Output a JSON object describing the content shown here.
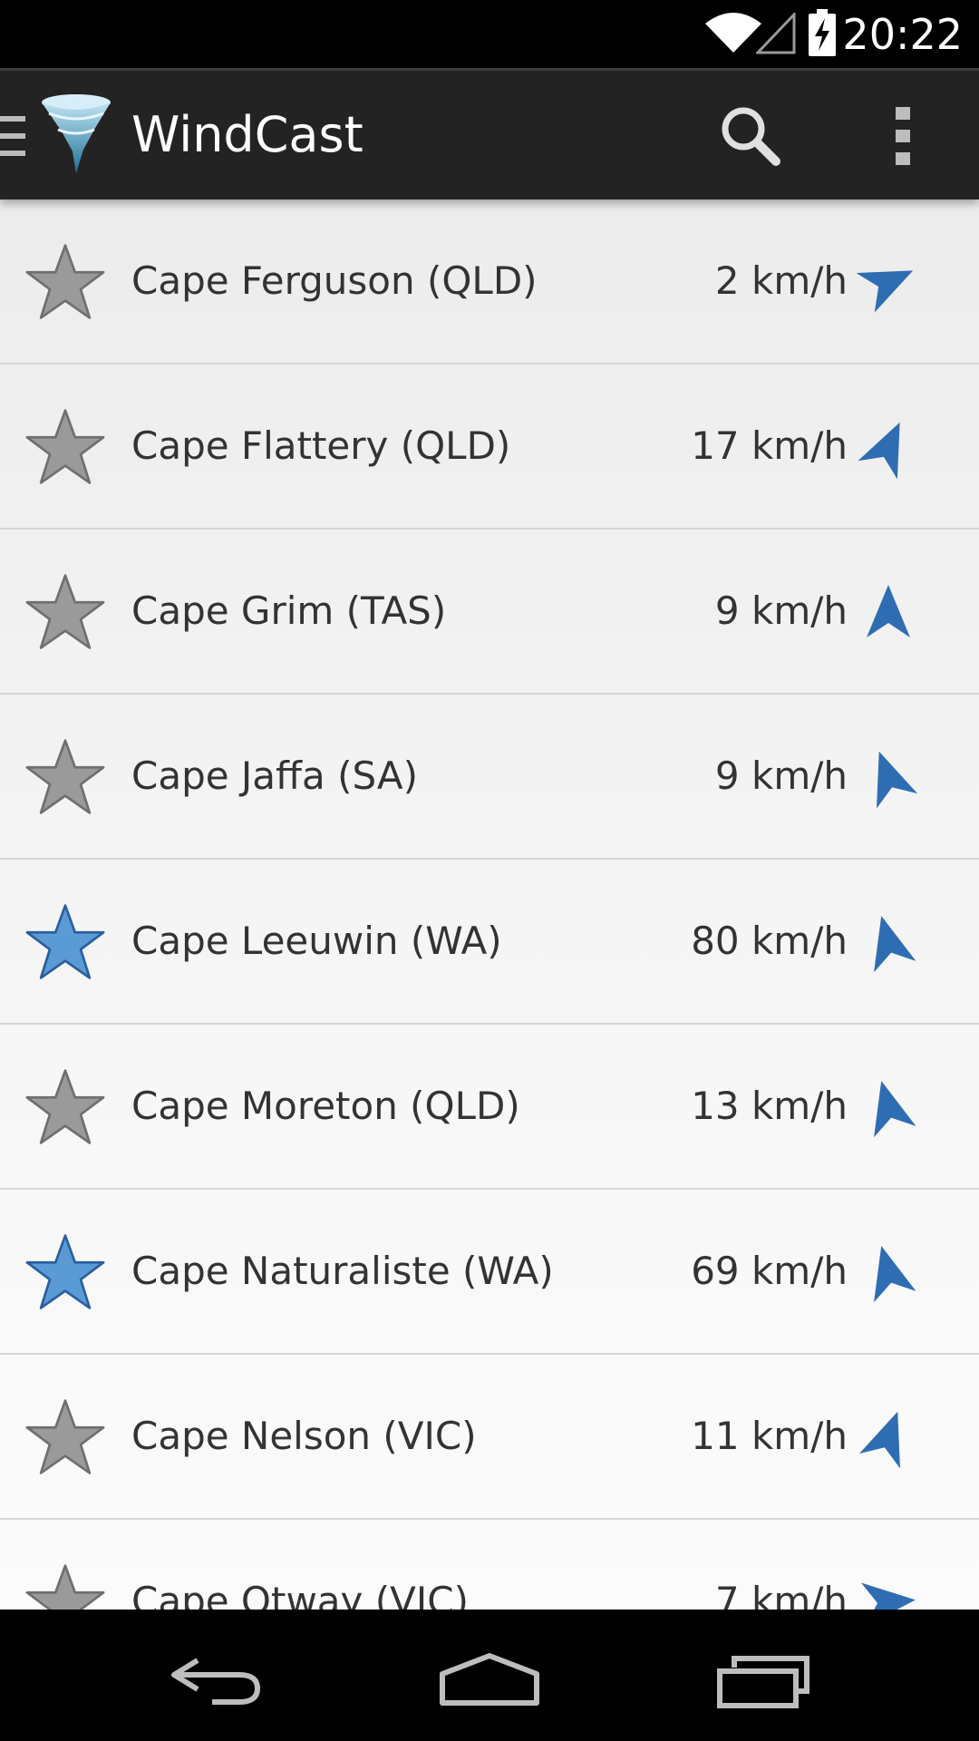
{
  "status_bar": {
    "time": "20:22"
  },
  "app": {
    "title": "WindCast"
  },
  "colors": {
    "accent": "#2f6db3",
    "star_off": "#9a9a9a",
    "star_on": "#5b9bd5"
  },
  "stations": [
    {
      "name": "Cape Ferguson (QLD)",
      "speed": "2 km/h",
      "favorite": false,
      "direction_deg": 155
    },
    {
      "name": "Cape Flattery (QLD)",
      "speed": "17 km/h",
      "favorite": false,
      "direction_deg": 115
    },
    {
      "name": "Cape Grim (TAS)",
      "speed": "9 km/h",
      "favorite": false,
      "direction_deg": 90
    },
    {
      "name": "Cape Jaffa (SA)",
      "speed": "9 km/h",
      "favorite": false,
      "direction_deg": 70
    },
    {
      "name": "Cape Leeuwin (WA)",
      "speed": "80 km/h",
      "favorite": true,
      "direction_deg": 75
    },
    {
      "name": "Cape Moreton (QLD)",
      "speed": "13 km/h",
      "favorite": false,
      "direction_deg": 75
    },
    {
      "name": "Cape Naturaliste (WA)",
      "speed": "69 km/h",
      "favorite": true,
      "direction_deg": 75
    },
    {
      "name": "Cape Nelson (VIC)",
      "speed": "11 km/h",
      "favorite": false,
      "direction_deg": 110
    },
    {
      "name": "Cape Otway (VIC)",
      "speed": "7 km/h",
      "favorite": false,
      "direction_deg": 175
    }
  ]
}
